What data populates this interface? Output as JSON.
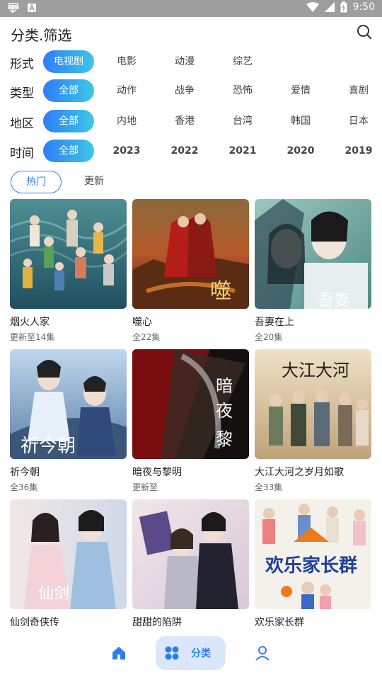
{
  "status_bar": {
    "time": "9:50"
  },
  "header": {
    "title": "分类.筛选"
  },
  "filters": {
    "form": {
      "label": "形式",
      "options": [
        "电视剧",
        "电影",
        "动漫",
        "综艺"
      ],
      "selected": "电视剧"
    },
    "genre": {
      "label": "类型",
      "options": [
        "全部",
        "动作",
        "战争",
        "恐怖",
        "爱情",
        "喜剧"
      ],
      "selected": "全部"
    },
    "region": {
      "label": "地区",
      "options": [
        "全部",
        "内地",
        "香港",
        "台湾",
        "韩国",
        "日本"
      ],
      "selected": "全部"
    },
    "year": {
      "label": "时间",
      "options": [
        "全部",
        "2023",
        "2022",
        "2021",
        "2020",
        "2019"
      ],
      "selected": "全部"
    }
  },
  "sort_tabs": {
    "hot": "热门",
    "latest": "更新"
  },
  "items": [
    {
      "title": "烟火人家",
      "subtitle": "更新至14集"
    },
    {
      "title": "噬心",
      "subtitle": "全22集"
    },
    {
      "title": "吾妻在上",
      "subtitle": "全20集"
    },
    {
      "title": "祈今朝",
      "subtitle": "全36集"
    },
    {
      "title": "暗夜与黎明",
      "subtitle": "更新至"
    },
    {
      "title": "大江大河之岁月如歌",
      "subtitle": "全33集"
    },
    {
      "title": "仙剑奇侠传",
      "subtitle": ""
    },
    {
      "title": "甜甜的陷阱",
      "subtitle": ""
    },
    {
      "title": "欢乐家长群",
      "subtitle": ""
    }
  ],
  "bottom_nav": {
    "category_label": "分类"
  },
  "colors": {
    "accent": "#2f7df6",
    "accent_end": "#3cc8e6",
    "status_bar": "#9e9e9e",
    "nav_active_bg": "#dbe8fb"
  }
}
